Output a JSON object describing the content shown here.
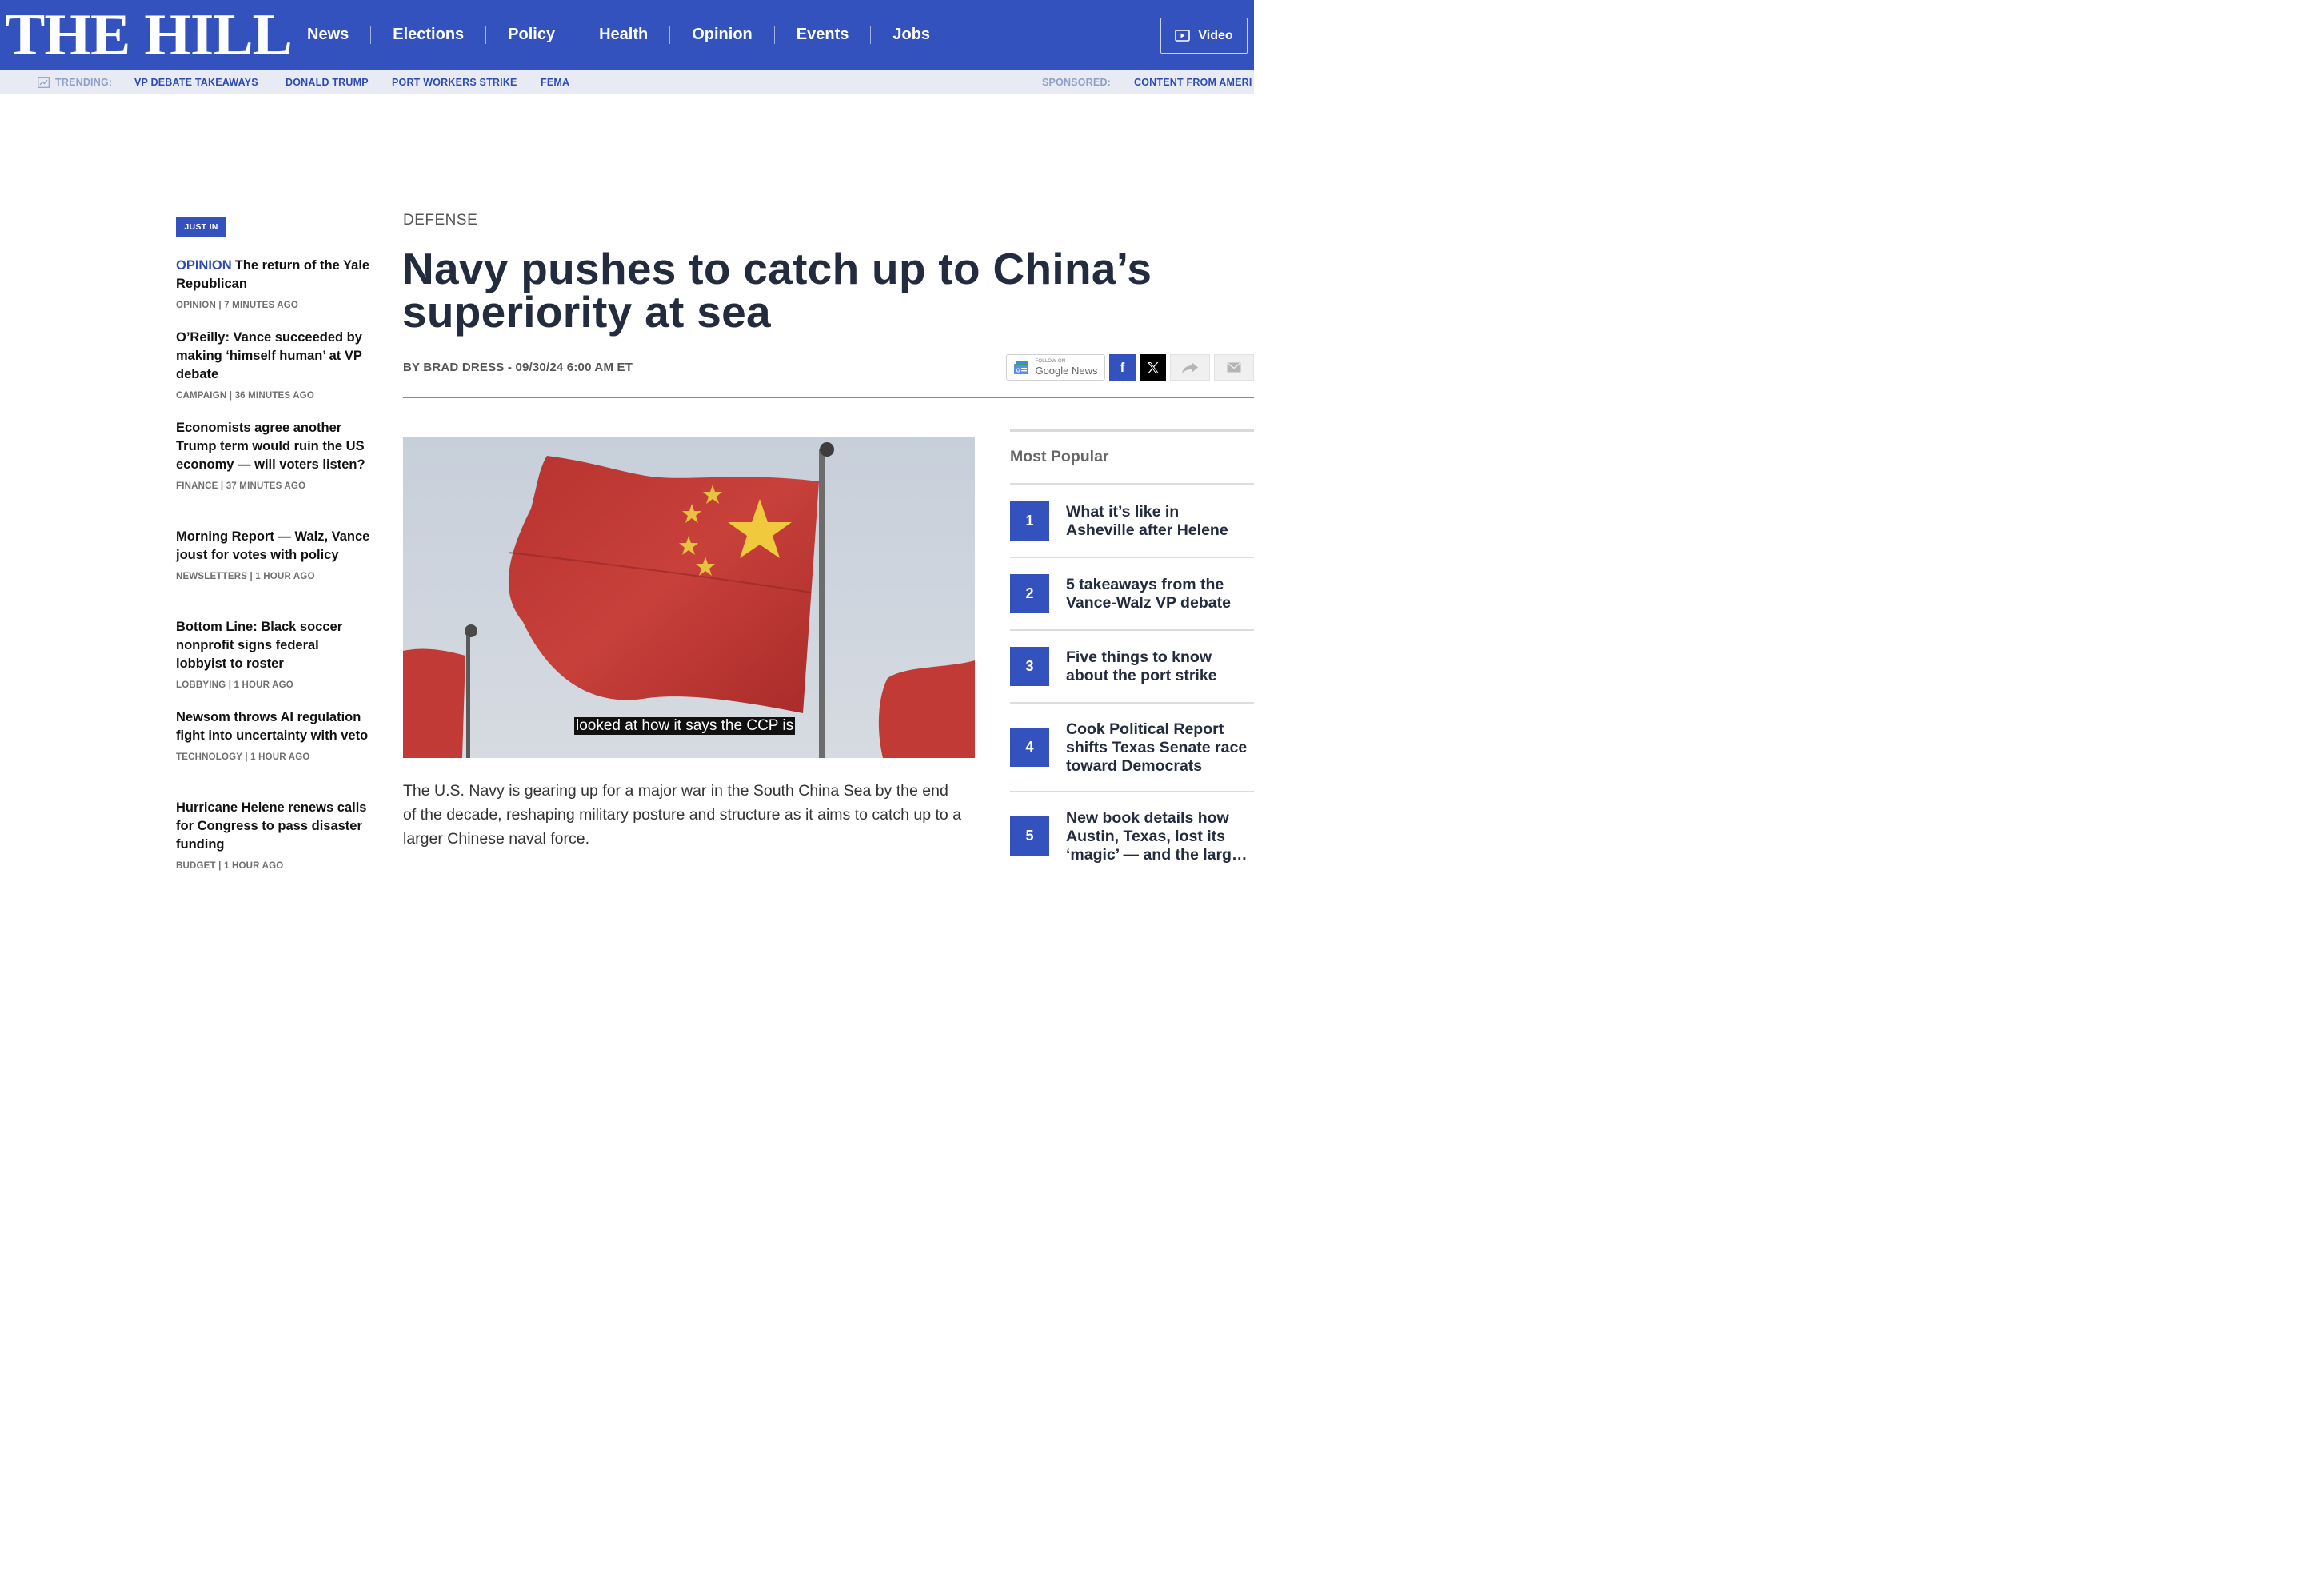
{
  "brand": {
    "logo_text": "THE HILL"
  },
  "nav": {
    "items": [
      "News",
      "Elections",
      "Policy",
      "Health",
      "Opinion",
      "Events",
      "Jobs"
    ],
    "video_label": "Video"
  },
  "trending": {
    "label": "TRENDING:",
    "links": [
      "VP DEBATE TAKEAWAYS",
      "DONALD TRUMP",
      "PORT WORKERS STRIKE",
      "FEMA"
    ],
    "sponsored_label": "SPONSORED:",
    "sponsored_link": "CONTENT FROM AMERI"
  },
  "just_in": {
    "badge": "JUST IN",
    "items": [
      {
        "tag": "OPINION",
        "title": "The return of the Yale Republican",
        "meta": "OPINION | 7 MINUTES AGO"
      },
      {
        "tag": "",
        "title": "O’Reilly: Vance succeeded by making ‘himself human’ at VP debate",
        "meta": "CAMPAIGN | 36 MINUTES AGO"
      },
      {
        "tag": "",
        "title": "Economists agree another Trump term would ruin the US economy — will voters listen?",
        "meta": "FINANCE | 37 MINUTES AGO"
      },
      {
        "tag": "",
        "title": "Morning Report — Walz, Vance joust for votes with policy",
        "meta": "NEWSLETTERS | 1 HOUR AGO"
      },
      {
        "tag": "",
        "title": "Bottom Line: Black soccer nonprofit signs federal lobbyist to roster",
        "meta": "LOBBYING | 1 HOUR AGO"
      },
      {
        "tag": "",
        "title": "Newsom throws AI regulation fight into uncertainty with veto",
        "meta": "TECHNOLOGY | 1 HOUR AGO"
      },
      {
        "tag": "",
        "title": "Hurricane Helene renews calls for Congress to pass disaster funding",
        "meta": "BUDGET | 1 HOUR AGO"
      }
    ]
  },
  "article": {
    "kicker": "DEFENSE",
    "headline": "Navy pushes to catch up to China’s superiority at sea",
    "byline": "BY BRAD DRESS - 09/30/24 6:00 AM ET",
    "video_caption": "looked at how it says the CCP is",
    "lede": "The U.S. Navy is gearing up for a major war in the South China Sea by the end of the decade, reshaping military posture and structure as it aims to catch up to a larger Chinese naval force."
  },
  "share": {
    "google_small": "FOLLOW ON",
    "google_brand": "Google",
    "google_news": "News",
    "facebook": "f"
  },
  "most_popular": {
    "title": "Most Popular",
    "items": [
      {
        "num": "1",
        "title": "What it’s like in Asheville after Helene"
      },
      {
        "num": "2",
        "title": "5 takeaways from the Vance-Walz VP debate"
      },
      {
        "num": "3",
        "title": "Five things to know about the port strike"
      },
      {
        "num": "4",
        "title": "Cook Political Report shifts Texas Senate race toward Democrats"
      },
      {
        "num": "5",
        "title": "New book details how Austin, Texas, lost its ‘magic’ — and the larg…"
      }
    ]
  },
  "colors": {
    "brand_blue": "#3452bd",
    "link_blue": "#2d4bb5",
    "headline": "#232b3e"
  }
}
